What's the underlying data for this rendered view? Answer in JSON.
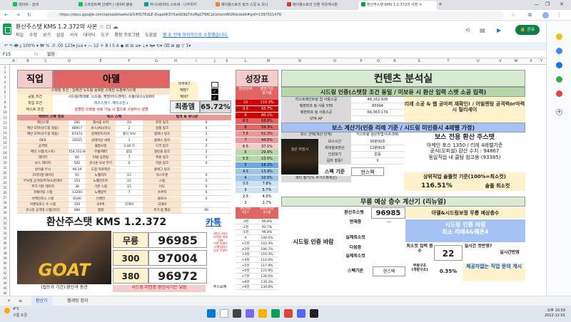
{
  "browser": {
    "tabs": [
      "데이버 - 검색",
      "스프린트팩 인베커 | 네이버 블로",
      "하나(세이버) 스트레 - 나무위키",
      "메이플스토리 링크 스킬 & 유니",
      "메이플스토리 인벤 자유게시판",
      "환산주스탯 KMS 1.2.372의 사본"
    ],
    "url": "https://docs.google.com/spreadsheets/d/14H1TEdLE-Dupe0K5Y5wdX9q7XvMpCF6KCpUzIromWURdc/edit#gid=1397551479",
    "window_controls": [
      "—",
      "❐",
      "✕"
    ]
  },
  "sheets": {
    "title": "환산주스탯 KMS 1.2.372의 사본",
    "menus": [
      "파일",
      "수정",
      "보기",
      "삽입",
      "서식",
      "데이터",
      "도구",
      "확장 프로그램",
      "도움말"
    ],
    "last_edit": "몇 초 전에 마지막으로 수정했습니다.",
    "share": "공유",
    "toolbar": "↶  ↷  🖶  ⤓  100%  ▾   ₩  %  .0  .00  123▾   Jua  ▾   —  12  +   B  I  S  A   ◆  ⊞  ⊟   ≡▾  ⊥▾  ↹▾  ↻▾   ⌫  ⊕  ▤  ▽  Σ▾",
    "namebox": "F15",
    "fx": "fx",
    "formula": "없음",
    "col_headers": [
      "A",
      "B",
      "C",
      "D",
      "E",
      "F",
      "G",
      "H",
      "I",
      "J",
      "K",
      "L",
      "M",
      "N",
      "O",
      "P",
      "Q",
      "R",
      "S",
      "T",
      "U",
      "V",
      "W",
      "X",
      "Y"
    ],
    "row_numbers": [
      "1",
      "2",
      "3",
      "4",
      "5",
      "6",
      "7",
      "8",
      "9",
      "10",
      "11",
      "12",
      "13",
      "14",
      "15",
      "16",
      "17",
      "18",
      "19",
      "20",
      "21",
      "22",
      "23",
      "24",
      "25",
      "26",
      "27",
      "28",
      "29",
      "30",
      "31",
      "32",
      "33",
      "34",
      "35",
      "36",
      "37",
      "38",
      "39",
      "40",
      "41",
      "42",
      "43",
      "44",
      "45",
      "46"
    ]
  },
  "job": {
    "label": "직업",
    "value": "아델",
    "reboot_q": "리부트?",
    "hyper_q": "해방?",
    "genesis_q": "제네?",
    "stat_note": "스탯창 조건 - 일랙션 노드링 중복된 스탯만 도핑후기스탯",
    "notes": [
      [
        "공통 조건",
        "시드링/최대화, 노드링, 펫장(어드벤처), 소울(보스)/1000"
      ],
      [
        "직업 조건",
        "",
        "레즈스탯↑, 메이소반↓"
      ],
      [
        "버스트 조건",
        "무릉!",
        "설명만 스탯을 사용 가능 시 접으로 사용하시 설명"
      ]
    ],
    "final_label": "최종뎀",
    "final_value": "65.72%"
  },
  "stats_left": {
    "headers": [
      "캐릭터 스펙 정보",
      "특스 스텍",
      "링크 & 유니온"
    ],
    "rows": [
      [
        "메인스탯",
        "281",
        "재사용 소지",
        "20",
        "로봇 링크",
        "6"
      ],
      [
        "메인 STR(유드링 착용)",
        "88917",
        "보스(AS)/유니",
        "2",
        "실캠 링크",
        "0"
      ],
      [
        "메인 STR(유드링 착용)",
        "87474",
        "방해뮤트/다수",
        "통닥 보보",
        "윗데나 링크",
        "2"
      ],
      [
        "DEX",
        "10525",
        "상태이상 내성",
        "1",
        "블래스 링크",
        "4"
      ],
      [
        "공격력",
        "",
        "출틈보정",
        "3-30 다",
        "드라 링크",
        "2"
      ],
      [
        "메인 스텝(옥스포)",
        "154,722.846",
        "무릉/메피",
        "없음",
        "질런을 링크",
        "2"
      ],
      [
        "데미지",
        "66",
        "어빌 상관링",
        "7",
        "폭렌 링크",
        "1"
      ],
      [
        "보스 데미지",
        "502",
        "유니온 보보 부기",
        "0",
        "하원 링크",
        "0"
      ],
      [
        "방어율 무시",
        "96.19",
        "도창 프로젝션",
        "",
        "플래그 링크",
        ""
      ],
      [
        "크리티컬 데미지",
        "95",
        "노벨리즈",
        "15",
        "익스트렌",
        "0"
      ],
      [
        "무보정 공격력/추하/소몬데미",
        "153",
        "노벨리즈트",
        "15",
        "스킬",
        "0"
      ],
      [
        "추가 기본 데미지",
        "38",
        "기본 스킬",
        "15",
        "이도",
        "0"
      ],
      [
        "하웨이팅 스텝",
        "13200",
        "노벨방주",
        "7",
        "쓰쿠지",
        "0"
      ],
      [
        "아케인포스 스텝",
        "6500",
        "인벤칸",
        "",
        "블로사",
        "0"
      ],
      [
        "어센틱포스 수 스텝",
        "150",
        "2바퀴",
        "고대비",
        "고대비",
        ""
      ],
      [
        "유니온 공격대 스텝(각인)",
        "680",
        "앰레",
        "",
        "추가 몹 월당",
        "90"
      ]
    ]
  },
  "bottom_left": {
    "title": "환산주스탯 KMS 1.2.372",
    "link": "카톡",
    "rows": [
      [
        "무릉",
        "96985"
      ],
      [
        "300",
        "97004"
      ],
      [
        "380",
        "96972"
      ]
    ],
    "side_note": "(분당 기준)\n 타작업 비교\n 가져\n 수한 수영수\n 스탯(상당)\n 당부 수영수",
    "image_text": "GOAT",
    "caption": "(씹쓰가 기간):환산과 동관",
    "button": "시드링 미인증 환산시기는 낮음",
    "extra": "추스요해"
  },
  "growth": {
    "title": "성장표",
    "head": [
      "환산단위",
      "분당기준\n증가율",
      "환산단위\n증가율"
    ],
    "rows": [
      [
        "10",
        "110.3%"
      ],
      [
        "9.5",
        "93.7%"
      ],
      [
        "9",
        "80.1%"
      ],
      [
        "8.5",
        "68.8%"
      ],
      [
        "8",
        "59.3%"
      ],
      [
        "7.5",
        "51.3%"
      ],
      [
        "7",
        "44.5%"
      ],
      [
        "6.5",
        "37.1%"
      ],
      [
        "6",
        "29.9%"
      ],
      [
        "5.5",
        "23.5%"
      ],
      [
        "5",
        "18.2%"
      ],
      [
        "4.5",
        "13.9%"
      ],
      [
        "4",
        "10.5%"
      ],
      [
        "3.5",
        "7.8%"
      ],
      [
        "3",
        "5.7%"
      ],
      [
        "2.5",
        "4.0%"
      ],
      [
        "2",
        "2.7%"
      ]
    ],
    "sub_head": [
      "분당기준\n기준+",
      "보라색 기준\n증가율",
      ""
    ],
    "rows2": [
      [
        "-3천",
        "90.8%"
      ],
      [
        "-2천",
        "93.7%"
      ],
      [
        "-1천",
        "96.8%"
      ],
      [
        "0",
        "100.0%"
      ],
      [
        "+1천",
        "103.3%"
      ],
      [
        "+2천",
        "106.7%"
      ],
      [
        "+3천",
        "110.3%"
      ],
      [
        "+4천",
        "114.0%"
      ],
      [
        "+5천",
        "117.9%"
      ],
      [
        "+6천",
        "121.9%"
      ],
      [
        "+7천",
        "126.0%"
      ],
      [
        "+8천",
        "130.3%"
      ],
      [
        "+9천",
        "134.8%"
      ]
    ]
  },
  "analysis": {
    "title": "컨텐츠 분석실",
    "seed_cond": "시드링 인증(스탯창 조건 동일 / 미보유 시 환산 입력 스탯 소공 입력)",
    "seed_rows": [
      [
        "리스트레인트링 입 사용스공",
        "48,162.926"
      ],
      [
        "웨펀퍼프 링 사용 STR",
        "85994"
      ],
      [
        "웨펀퍼프 링 사용스공",
        "66,363.174"
      ],
      [
        "STR AP",
        ""
      ]
    ],
    "seed_right": "리레 소공 & 웹 공마퍼 재확인! / 어빌렌탕 공격력or마력 시 릴리세이",
    "boss_title": "보스 계산기(인증 리레 기준 / 시드링 미인증시 4레벨 가정)",
    "boss_head": [
      "보스 선택(계산 단계)",
      "익스트림 검은마법사(4:3배)"
    ],
    "boss_rows": [
      [
        "보스시간",
        "30분00초"
      ],
      [
        "최대솔로환산",
        "12분00초"
      ],
      [
        "인원보기",
        "없음"
      ],
      [
        "길마 찰풍?",
        "X"
      ]
    ],
    "boss_right": "보스 전용 환산 주스탯",
    "boss_image_text": "검은 마법사",
    "boss_desc": "아케인 포스 1350 / 리레 4레벨기준\n공식(오피셜) 환산 수치 : 94867\n동일직업 내 클탐 참고용 (93385)",
    "spec_label": "스펙 기준",
    "spec_value": "현스펙",
    "party_label": "파티 평가(% 추가스펙계산)",
    "party_value": "",
    "ratio_label": "상위직업 솔플컷 기준(100%=최소컷)",
    "ratio_value": "116.51%",
    "ratio_right": "솔플 최소컷",
    "muleung_title": "무릉 예상 층수 계산기 (리뉴얼)",
    "env_label": "환산주스탯",
    "env_value": "96985",
    "muleung_right": "아델&시드링보정 무릉 예상층수",
    "seed_banner": "시드링 인증 바람\n최소 리레4&웨폰4",
    "seed_cert": "시드링 인증 바람",
    "current": [
      "현재층",
      "실제최소컷"
    ],
    "next": [
      "다음층",
      "실제최소컷"
    ],
    "min_hit_label": "최소컷 입력 층수",
    "min_hit_value": "22",
    "actual_label": "실시간 컷반영?",
    "actual_right": "실시간반영",
    "recipe_label": "무릉구조\n(개량구조)",
    "recipe_value": "0.35%",
    "suggest": "제공자없는 직업 문의 게시",
    "spec_row_label": "스펙기준",
    "spec_row_value": "현스펙"
  },
  "sheet_tabs": [
    "+",
    "≡",
    "환산기",
    "웹세팅 정리"
  ],
  "taskbar": {
    "weather": "4°C",
    "weather_sub": "구름 조금",
    "time": "오후 10:59",
    "date": "2022-12-01"
  }
}
